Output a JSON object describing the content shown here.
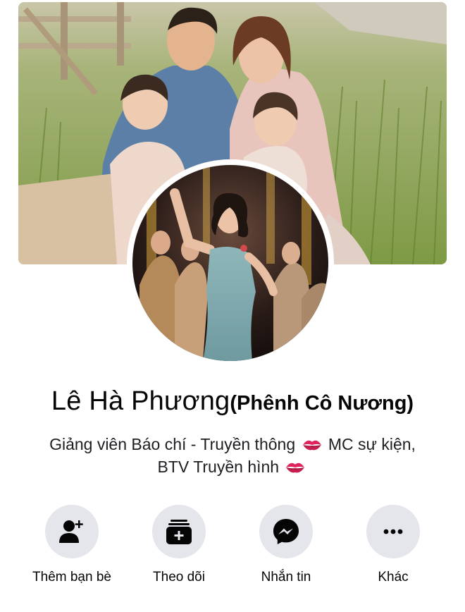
{
  "profile": {
    "name": "Lê Hà Phương",
    "nickname": "(Phênh Cô Nương)",
    "bio_line1_part1": "Giảng viên Báo chí - Truyền thông",
    "bio_line1_part2": "MC sự kiện,",
    "bio_line2": "BTV Truyền hình"
  },
  "actions": [
    {
      "label": "Thêm bạn bè",
      "icon": "add-friend-icon"
    },
    {
      "label": "Theo dõi",
      "icon": "follow-icon"
    },
    {
      "label": "Nhắn tin",
      "icon": "messenger-icon"
    },
    {
      "label": "Khác",
      "icon": "more-icon"
    }
  ],
  "colors": {
    "action_bg": "#e4e6eb",
    "icon": "#050505",
    "lips": "#e0245e"
  }
}
